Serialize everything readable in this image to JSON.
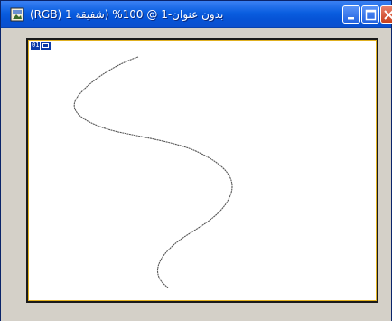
{
  "window": {
    "title": "(RGB) بدون عنوان-1 @ 100% (شفيقة 1",
    "controls": {
      "minimize": "minimize",
      "maximize": "maximize",
      "close": "close"
    },
    "colors": {
      "titlebar": "#0a5ee0",
      "canvas_border": "#1a1a1a",
      "canvas_inner_border": "#e0b020",
      "canvas_background": "#ffffff",
      "chrome": "#d4d0c8",
      "path_stroke": "#555555",
      "badge": "#0a3aa8"
    }
  },
  "canvas": {
    "layer_badge": {
      "number": "01",
      "icon": "layer-mask-icon"
    },
    "path": {
      "icon": "curved-path-icon"
    }
  }
}
